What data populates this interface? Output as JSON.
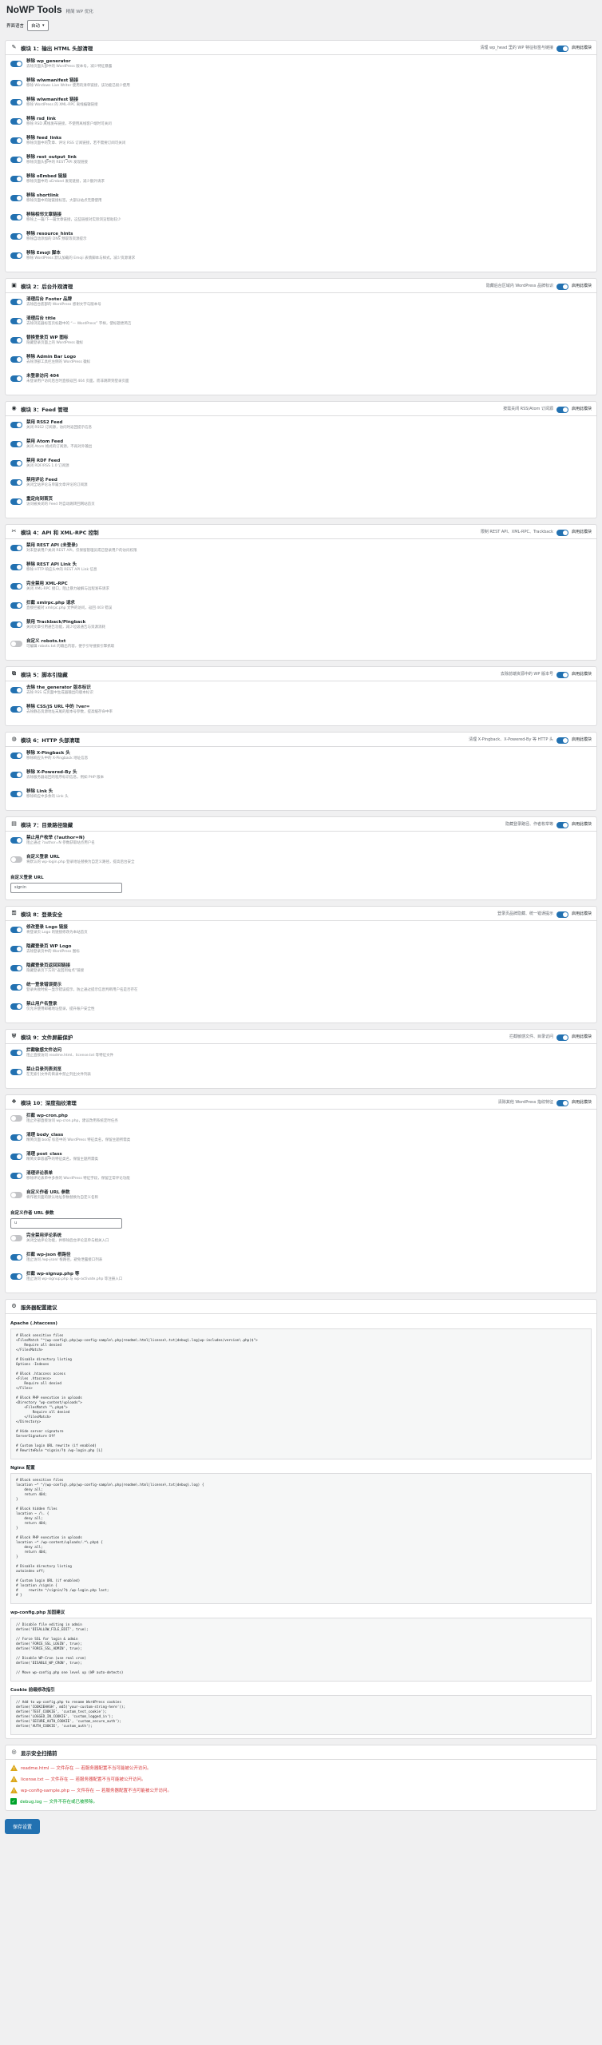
{
  "header": {
    "title": "NoWP Tools",
    "subtitle": "精简 WP 优化",
    "lang_label": "界面语言",
    "lang_value": "自动"
  },
  "colors": {
    "accent": "#2271b1",
    "toggle_off": "#c3c4c7",
    "warn": "#d63638",
    "ok": "#00a32a"
  },
  "modules": [
    {
      "title": "模块 1：输出 HTML 头部清理",
      "icon": "broom-icon",
      "desc": "清理 wp_head 里的 WP 特征标签与链接",
      "master_label": "启用此模块",
      "items": [
        {
          "t": "移除 wp_generator",
          "d": "去除页面头部中的 WordPress 版本号，减少特征暴露",
          "on": true
        },
        {
          "t": "移除 wlwmanifest 链接",
          "d": "移除 Windows Live Writer 使用的清单链接，该功能已很少使用",
          "on": true
        },
        {
          "t": "移除 wlwmanifest 链接",
          "d": "移除 WordPress 的 XML-RPC 离线编辑链接",
          "on": true
        },
        {
          "t": "移除 rsd_link",
          "d": "移除 RSD 离线发布链接，不使用离线客户端时可关闭",
          "on": true
        },
        {
          "t": "移除 feed_links",
          "d": "移除页面中的文章、评论 RSS 订阅链接，若不需要订阅可关闭",
          "on": true
        },
        {
          "t": "移除 rest_output_link",
          "d": "移除页面头部中的 REST API 发现链接",
          "on": true
        },
        {
          "t": "移除 oEmbed 链接",
          "d": "移除页面中的 oEmbed 发现链接，减少额外请求",
          "on": true
        },
        {
          "t": "移除 shortlink",
          "d": "移除页面中的短链接标签，大部分站点无需使用",
          "on": true
        },
        {
          "t": "移除相邻文章链接",
          "d": "移除上一篇/下一篇文章链接，这些链接对实际浏览帮助较少",
          "on": true
        },
        {
          "t": "移除 resource_hints",
          "d": "移除自动添加的 DNS 预取等资源提示",
          "on": true
        },
        {
          "t": "移除 Emoji 脚本",
          "d": "移除 WordPress 默认加载的 Emoji 表情脚本与样式，减少资源请求",
          "on": true
        }
      ]
    },
    {
      "title": "模块 2：后台外观清理",
      "icon": "monitor-icon",
      "desc": "隐藏后台区域内 WordPress 品牌标识",
      "master_label": "启用此模块",
      "items": [
        {
          "t": "清理后台 Footer 品牌",
          "d": "去除后台底部的 WordPress 感谢文字与版本号",
          "on": true
        },
        {
          "t": "清理后台 title",
          "d": "去除浏览器标签页标题中的 “— WordPress” 字样，使标题更简洁",
          "on": true
        },
        {
          "t": "替换登录页 WP 图标",
          "d": "隐藏登录页面上的 WordPress 徽标",
          "on": true
        },
        {
          "t": "移除 Admin Bar Logo",
          "d": "去除顶部工具栏左侧的 WordPress 徽标",
          "on": true
        },
        {
          "t": "未登录访问 404",
          "d": "未登录用户访问后台时直接返回 404 页面，而非跳转到登录页面",
          "on": true
        }
      ]
    },
    {
      "title": "模块 3：Feed 管理",
      "icon": "rss-icon",
      "desc": "按需关闭 RSS/Atom 订阅源",
      "master_label": "启用此模块",
      "items": [
        {
          "t": "禁用 RSS2 Feed",
          "d": "关闭 RSS2 订阅源，访问时返回提示信息",
          "on": true
        },
        {
          "t": "禁用 Atom Feed",
          "d": "关闭 Atom 格式的订阅源，不再对外输出",
          "on": true
        },
        {
          "t": "禁用 RDF Feed",
          "d": "关闭 RDF/RSS 1.0 订阅源",
          "on": true
        },
        {
          "t": "禁用评论 Feed",
          "d": "关闭全站评论与单篇文章评论的订阅源",
          "on": true
        },
        {
          "t": "重定向到首页",
          "d": "访问被关闭的 Feed 时自动跳转回网站首页",
          "on": true
        }
      ]
    },
    {
      "title": "模块 4：API 和 XML-RPC 控制",
      "icon": "wrench-icon",
      "desc": "限制 REST API、XML-RPC、Trackback",
      "master_label": "启用此模块",
      "items": [
        {
          "t": "禁用 REST API (未登录)",
          "d": "对未登录用户关闭 REST API，仅保留管理员或已登录用户的访问权限",
          "on": true
        },
        {
          "t": "移除 REST API Link 头",
          "d": "移除 HTTP 响应头中的 REST API Link 信息",
          "on": true
        },
        {
          "t": "完全禁用 XML-RPC",
          "d": "关闭 XML-RPC 接口，阻止暴力破解与远程发布请求",
          "on": true
        },
        {
          "t": "拦截 xmlrpc.php 请求",
          "d": "直接拦截对 xmlrpc.php 文件的访问，返回 403 错误",
          "on": true
        },
        {
          "t": "禁用 Trackback/Pingback",
          "d": "关闭文章引用通告功能，减少垃圾通告与资源消耗",
          "on": true
        },
        {
          "t": "自定义 robots.txt",
          "d": "可编辑 robots.txt 的输出内容，便于引导搜索引擎抓取",
          "on": false
        }
      ]
    },
    {
      "title": "模块 5：脚本引隐藏",
      "icon": "script-icon",
      "desc": "去除前端资源中的 WP 版本号",
      "master_label": "启用此模块",
      "items": [
        {
          "t": "去除 the_generator 版本标识",
          "d": "去除 RSS 与页面中生成器输出的版本标识",
          "on": true
        },
        {
          "t": "移除 CSS/JS URL 中的 ?ver=",
          "d": "去除静态资源地址末尾的版本号参数，提高缓存命中率",
          "on": true
        }
      ]
    },
    {
      "title": "模块 6：HTTP 头部清理",
      "icon": "globe-icon",
      "desc": "清理 X-Pingback、X-Powered-By 等 HTTP 头",
      "master_label": "启用此模块",
      "items": [
        {
          "t": "移除 X-Pingback 头",
          "d": "移除响应头中的 X-Pingback 地址信息",
          "on": true
        },
        {
          "t": "移除 X-Powered-By 头",
          "d": "去除服务器返回的程序标识信息，例如 PHP 版本",
          "on": true
        },
        {
          "t": "移除 Link 头",
          "d": "移除响应中多余的 Link 头",
          "on": true
        }
      ]
    },
    {
      "title": "模块 7：目录路径隐藏",
      "icon": "folder-icon",
      "desc": "隐藏登录路径、作者枚举等",
      "master_label": "启用此模块",
      "items": [
        {
          "t": "禁止用户枚举 (?author=N)",
          "d": "阻止通过 ?author=N 参数获取站点用户名",
          "on": true
        },
        {
          "t": "自定义登录 URL",
          "d": "将默认的 wp-login.php 登录地址替换为自定义路径，提高后台安全",
          "on": false
        }
      ],
      "field": {
        "label": "自定义登录 URL",
        "value": "signin"
      }
    },
    {
      "title": "模块 8：登录安全",
      "icon": "lock-icon",
      "desc": "登录页品牌隐藏、统一错误提示",
      "master_label": "启用此模块",
      "items": [
        {
          "t": "修改登录 Logo 链接",
          "d": "将登录页 Logo 的链接修改为本站首页",
          "on": true
        },
        {
          "t": "隐藏登录页 WP Logo",
          "d": "去除登录页中的 WordPress 图标",
          "on": true
        },
        {
          "t": "隐藏登录页返回回链接",
          "d": "隐藏登录页下方的“返回到站点”链接",
          "on": true
        },
        {
          "t": "统一登录错误提示",
          "d": "登录失败时统一显示错误提示，防止通过提示信息判断用户名是否存在",
          "on": true
        },
        {
          "t": "禁止用户名登录",
          "d": "仅允许使用邮箱地址登录，提升账户安全性",
          "on": true
        }
      ]
    },
    {
      "title": "模块 9：文件屏蔽保护",
      "icon": "shield-icon",
      "desc": "拦截敏感文件、目录访问",
      "master_label": "启用此模块",
      "items": [
        {
          "t": "拦截敏感文件访问",
          "d": "阻止直接访问 readme.html、license.txt 等特征文件",
          "on": true
        },
        {
          "t": "禁止目录列表浏览",
          "d": "在无索引文件的目录中禁止列出文件列表",
          "on": true
        }
      ]
    },
    {
      "title": "模块 10：深度指纹清理",
      "icon": "fingerprint-icon",
      "desc": "清除其他 WordPress 指纹特征",
      "master_label": "启用此模块",
      "items": [
        {
          "t": "拦截 wp-cron.php",
          "d": "阻止外部直接访问 wp-cron.php，建议改用系统定时任务",
          "on": false
        },
        {
          "t": "清理 body_class",
          "d": "精简页面 body 标签中的 WordPress 特征类名，保留主题所需类",
          "on": true
        },
        {
          "t": "清理 post_class",
          "d": "精简文章容器中的特征类名，保留主题所需类",
          "on": true
        },
        {
          "t": "清理评论表单",
          "d": "移除评论表单中多余的 WordPress 特征字段，保留正常评论功能",
          "on": true
        },
        {
          "t": "自定义作者 URL 参数",
          "d": "将作者页面的默认地址参数替换为自定义名称",
          "on": false
        }
      ],
      "field": {
        "label": "自定义作者 URL 参数",
        "value": "u"
      },
      "items_after": [
        {
          "t": "完全禁用评论系统",
          "d": "关闭全站评论功能，并移除后台评论菜单与相关入口",
          "on": false
        },
        {
          "t": "拦截 wp-json 根路径",
          "d": "阻止访问 /wp-json/ 根路径，避免泄露接口列表",
          "on": true
        },
        {
          "t": "拦截 wp-signup.php 等",
          "d": "阻止访问 wp-signup.php 与 wp-activate.php 等注册入口",
          "on": true
        }
      ]
    }
  ],
  "server": {
    "title": "服务器配置建议",
    "icon": "gear-icon",
    "blocks": [
      {
        "label": "Apache (.htaccess)",
        "code": "# Block sensitive files\n<FilesMatch \"^(wp-config\\.php|wp-config-sample\\.php|readme\\.html|license\\.txt|debug\\.log|wp-includes/version\\.php)$\">\n    Require all denied\n</FilesMatch>\n\n# Disable directory listing\nOptions -Indexes\n\n# Block .htaccess access\n<Files .htaccess>\n    Require all denied\n</Files>\n\n# Block PHP execution in uploads\n<Directory \"wp-content/uploads\">\n    <FilesMatch \"\\.php$\">\n        Require all denied\n    </FilesMatch>\n</Directory>\n\n# Hide server signature\nServerSignature Off\n\n# Custom login URL rewrite (if enabled)\n# RewriteRule ^signin/?$ /wp-login.php [L]"
      },
      {
        "label": "Nginx 配置",
        "code": "# Block sensitive files\nlocation ~* ^/(wp-config\\.php|wp-config-sample\\.php|readme\\.html|license\\.txt|debug\\.log) {\n    deny all;\n    return 404;\n}\n\n# Block hidden files\nlocation ~ /\\. {\n    deny all;\n    return 404;\n}\n\n# Block PHP execution in uploads\nlocation ~* /wp-content/uploads/.*\\.php$ {\n    deny all;\n    return 404;\n}\n\n# Disable directory listing\nautoindex off;\n\n# Custom login URL (if enabled)\n# location /signin {\n#     rewrite ^/signin/?$ /wp-login.php last;\n# }"
      },
      {
        "label": "wp-config.php 加固建议",
        "code": "// Disable file editing in admin\ndefine('DISALLOW_FILE_EDIT', true);\n\n// Force SSL for login & admin\ndefine('FORCE_SSL_LOGIN', true);\ndefine('FORCE_SSL_ADMIN', true);\n\n// Disable WP-Cron (use real cron)\ndefine('DISABLE_WP_CRON', true);\n\n// Move wp-config.php one level up (WP auto-detects)"
      },
      {
        "label": "Cookie 前缀修改指引",
        "code": "// Add to wp-config.php to rename WordPress cookies\ndefine('COOKIEHASH', md5('your-custom-string-here'));\ndefine('TEST_COOKIE', 'custom_test_cookie');\ndefine('LOGGED_IN_COOKIE', 'custom_logged_in');\ndefine('SECURE_AUTH_COOKIE', 'custom_secure_auth');\ndefine('AUTH_COOKIE', 'custom_auth');"
      }
    ]
  },
  "files_check": {
    "title": "显示安全扫描前",
    "icon": "scan-icon",
    "rows": [
      {
        "text": "readme.html — 文件存在 — 若服务器配置不当可能被公开访问。",
        "status": "warn"
      },
      {
        "text": "license.txt — 文件存在 — 若服务器配置不当可能被公开访问。",
        "status": "warn"
      },
      {
        "text": "wp-config-sample.php — 文件存在 — 若服务器配置不当可能被公开访问。",
        "status": "warn"
      },
      {
        "text": "debug.log — 文件不存在或已被移除。",
        "status": "ok"
      }
    ]
  },
  "save_label": "保存设置"
}
